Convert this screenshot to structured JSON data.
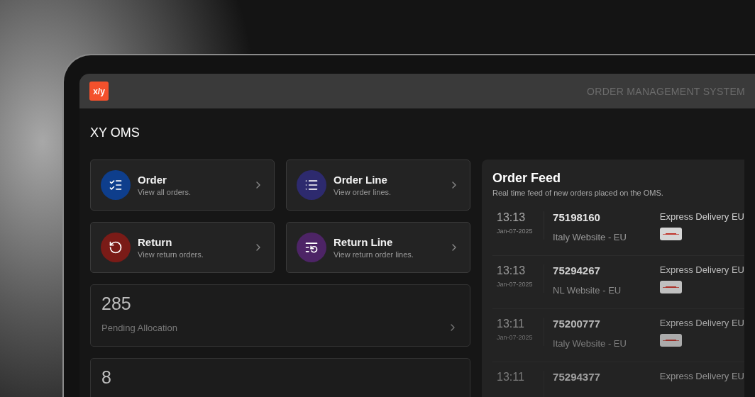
{
  "header": {
    "logo": "x/y",
    "title": "ORDER MANAGEMENT SYSTEM"
  },
  "page_title": "XY OMS",
  "nav_cards": [
    {
      "title": "Order",
      "subtitle": "View all orders.",
      "color": "#0e3e8c"
    },
    {
      "title": "Order Line",
      "subtitle": "View order lines.",
      "color": "#2d2a6e"
    },
    {
      "title": "Return",
      "subtitle": "View return orders.",
      "color": "#7a1b17"
    },
    {
      "title": "Return Line",
      "subtitle": "View return order lines.",
      "color": "#4d2466"
    }
  ],
  "stats": [
    {
      "value": "285",
      "label": "Pending Allocation"
    },
    {
      "value": "8"
    }
  ],
  "order_feed": {
    "title": "Order Feed",
    "subtitle": "Real time feed of new orders placed on the OMS.",
    "orders": [
      {
        "time": "13:13",
        "date": "Jan-07-2025",
        "number": "75198160",
        "channel": "Italy Website - EU",
        "delivery": "Express Delivery EU"
      },
      {
        "time": "13:13",
        "date": "Jan-07-2025",
        "number": "75294267",
        "channel": "NL Website - EU",
        "delivery": "Express Delivery EU"
      },
      {
        "time": "13:11",
        "date": "Jan-07-2025",
        "number": "75200777",
        "channel": "Italy Website - EU",
        "delivery": "Express Delivery EU"
      },
      {
        "time": "13:11",
        "number": "75294377",
        "delivery": "Express Delivery EU"
      }
    ]
  }
}
